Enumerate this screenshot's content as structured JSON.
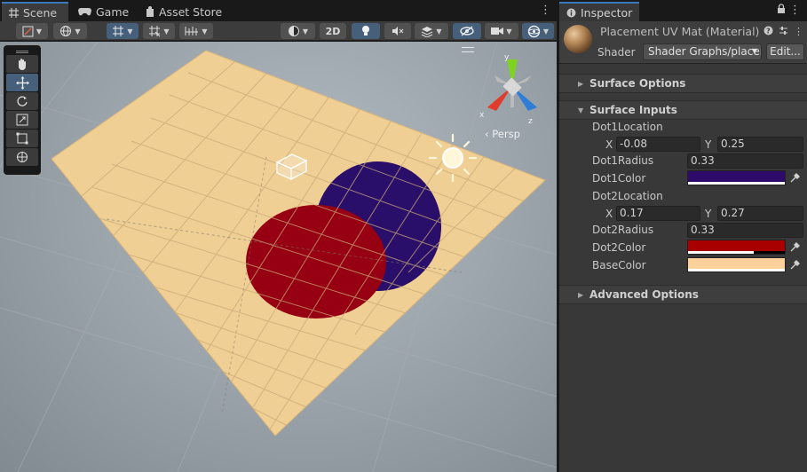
{
  "scene_tabs": {
    "scene": {
      "label": "Scene",
      "icon": "hash-grid-icon"
    },
    "game": {
      "label": "Game",
      "icon": "gamepad-icon"
    },
    "asset_store": {
      "label": "Asset Store",
      "icon": "bag-icon"
    }
  },
  "scene_toolbar": {
    "twod_label": "2D",
    "items": [
      "draw-mode-dropdown",
      "render-mode-dropdown",
      "grid-snapping-toggle",
      "increment-snapping-toggle",
      "snap-settings",
      "shading-dropdown",
      "2d-toggle",
      "lighting-toggle",
      "audio-toggle",
      "effects-dropdown",
      "hidden-objects-toggle",
      "camera-dropdown",
      "gizmos-dropdown"
    ]
  },
  "tools": [
    "hand-tool",
    "move-tool",
    "rotate-tool",
    "scale-tool",
    "rect-tool",
    "transform-tool"
  ],
  "active_tool": "move-tool",
  "viewport": {
    "persp_label": "‹ Persp",
    "gizmo_axes": [
      "x",
      "y",
      "z"
    ],
    "colors": {
      "plane": "#f0cf95",
      "dot1": "#2a0f6a",
      "dot2": "#960012",
      "sun": "#fff7d8"
    }
  },
  "inspector": {
    "tab_label": "Inspector",
    "material_name": "Placement UV Mat (Material)",
    "shader_label": "Shader",
    "shader_value": "Shader Graphs/placement",
    "edit_label": "Edit...",
    "sections": {
      "surface_options": "Surface Options",
      "surface_inputs": "Surface Inputs",
      "advanced_options": "Advanced Options"
    },
    "props": {
      "dot1_location": {
        "label": "Dot1Location",
        "x_label": "X",
        "x": "-0.08",
        "y_label": "Y",
        "y": "0.25"
      },
      "dot1_radius": {
        "label": "Dot1Radius",
        "value": "0.33"
      },
      "dot1_color": {
        "label": "Dot1Color",
        "color": "#2e0b6b",
        "alpha": 1.0
      },
      "dot2_location": {
        "label": "Dot2Location",
        "x_label": "X",
        "x": "0.17",
        "y_label": "Y",
        "y": "0.27"
      },
      "dot2_radius": {
        "label": "Dot2Radius",
        "value": "0.33"
      },
      "dot2_color": {
        "label": "Dot2Color",
        "color": "#a80000",
        "alpha": 0.68
      },
      "base_color": {
        "label": "BaseColor",
        "color": "#fdd19c",
        "alpha": 1.0
      }
    }
  }
}
